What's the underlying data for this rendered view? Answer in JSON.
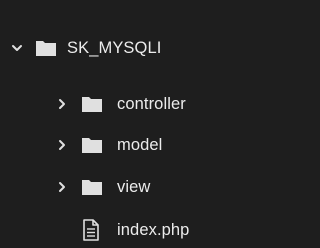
{
  "explorer": {
    "root": {
      "label": "SK_MYSQLI",
      "expanded": true,
      "icon": "folder-icon"
    },
    "items": [
      {
        "label": "controller",
        "type": "folder",
        "expanded": false,
        "icon": "folder-icon"
      },
      {
        "label": "model",
        "type": "folder",
        "expanded": false,
        "icon": "folder-icon"
      },
      {
        "label": "view",
        "type": "folder",
        "expanded": false,
        "icon": "folder-icon"
      },
      {
        "label": "index.php",
        "type": "file",
        "icon": "file-icon"
      }
    ]
  },
  "colors": {
    "background": "#1e1e1e",
    "text": "#ececec",
    "icon": "#e0e0e0"
  }
}
